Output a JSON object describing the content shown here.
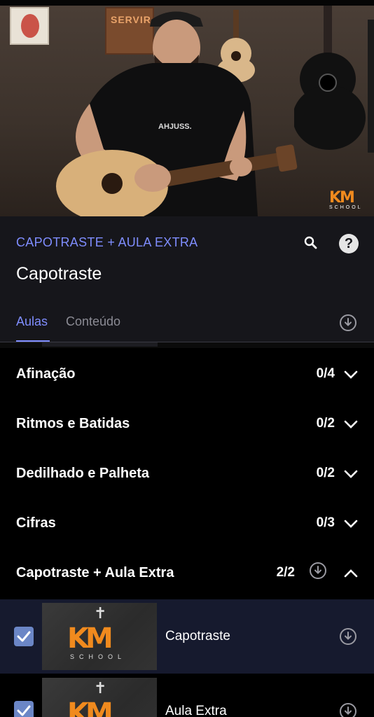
{
  "video": {
    "logo_text": "KM",
    "logo_subtext": "SCHOOL"
  },
  "header": {
    "course_title": "CAPOTRASTE + AULA EXTRA",
    "lesson_title": "Capotraste",
    "help_symbol": "?",
    "tabs": [
      {
        "label": "Aulas",
        "active": true
      },
      {
        "label": "Conteúdo",
        "active": false
      }
    ]
  },
  "sections": [
    {
      "name": "Afinação",
      "progress": "0/4",
      "expanded": false
    },
    {
      "name": "Ritmos e Batidas",
      "progress": "0/2",
      "expanded": false
    },
    {
      "name": "Dedilhado e Palheta",
      "progress": "0/2",
      "expanded": false
    },
    {
      "name": "Cifras",
      "progress": "0/3",
      "expanded": false
    },
    {
      "name": "Capotraste + Aula Extra",
      "progress": "2/2",
      "expanded": true
    }
  ],
  "lessons": [
    {
      "title": "Capotraste",
      "completed": true,
      "active": true
    },
    {
      "title": "Aula Extra",
      "completed": true,
      "active": false
    }
  ],
  "colors": {
    "accent": "#7f8dff",
    "brand_orange": "#f08a1e",
    "header_bg": "#16161b",
    "active_row_bg": "#161a2e",
    "checkbox": "#6b86c6"
  },
  "icons": [
    "search-icon",
    "help-icon",
    "download-icon",
    "chevron-down-icon",
    "chevron-up-icon",
    "check-icon"
  ]
}
